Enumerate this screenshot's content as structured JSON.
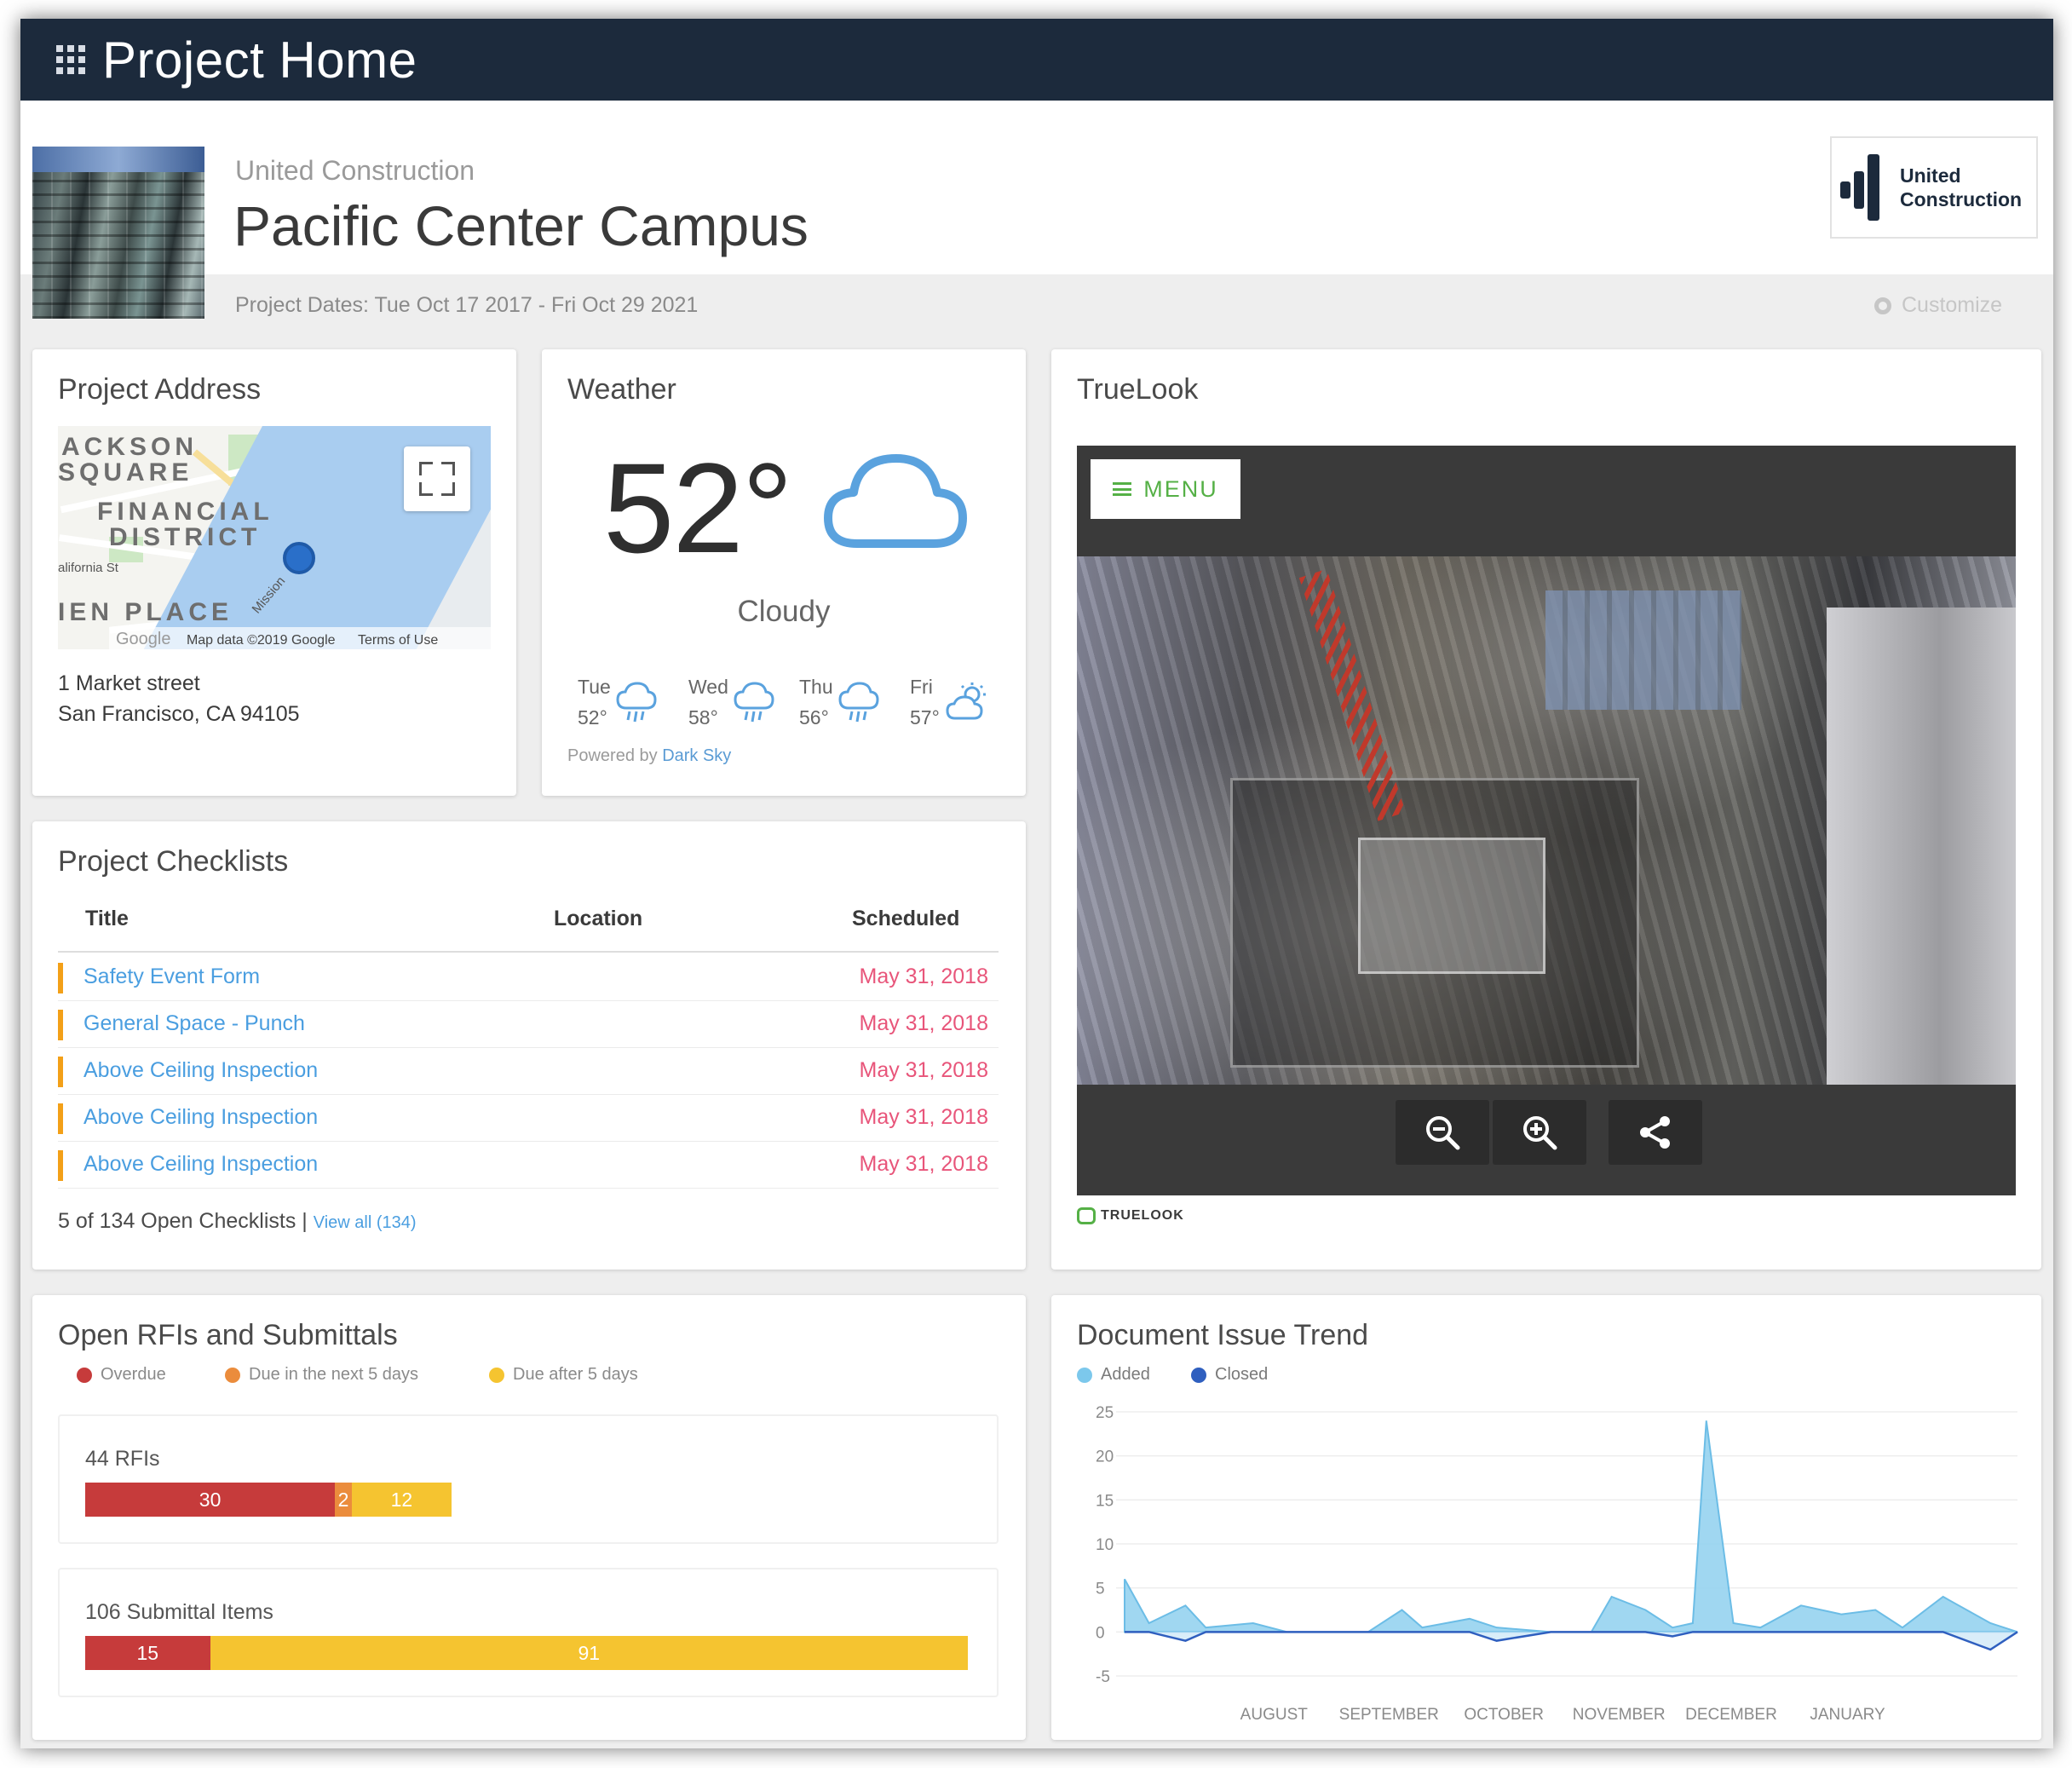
{
  "app": {
    "title": "Project Home",
    "apps_icon": "app-grid-icon"
  },
  "project": {
    "company": "United Construction",
    "name": "Pacific Center Campus",
    "dates": "Project Dates: Tue Oct 17 2017 - Fri Oct 29 2021",
    "customize_label": "Customize",
    "logo_line1": "United",
    "logo_line2": "Construction"
  },
  "address": {
    "title": "Project Address",
    "line1": "1 Market street",
    "line2": "San Francisco, CA 94105",
    "map_labels": [
      "ACKSON",
      "SQUARE",
      "FINANCIAL",
      "DISTRICT",
      "IEN PLACE"
    ],
    "map_small_labels": [
      "alifornia St",
      "Mission"
    ],
    "map_attribution": "Map data ©2019 Google",
    "map_terms": "Terms of Use",
    "map_brand": "Google"
  },
  "weather": {
    "title": "Weather",
    "temperature": "52°",
    "condition": "Cloudy",
    "condition_icon": "cloud-icon",
    "forecast": [
      {
        "day": "Tue",
        "temp": "52°",
        "icon": "rain-cloud-icon"
      },
      {
        "day": "Wed",
        "temp": "58°",
        "icon": "rain-cloud-icon"
      },
      {
        "day": "Thu",
        "temp": "56°",
        "icon": "rain-cloud-icon"
      },
      {
        "day": "Fri",
        "temp": "57°",
        "icon": "partly-cloudy-icon"
      }
    ],
    "powered_prefix": "Powered by",
    "powered_link": "Dark Sky"
  },
  "truelook": {
    "title": "TrueLook",
    "menu_label": "MENU",
    "controls": [
      "zoom-out-icon",
      "zoom-in-icon",
      "share-icon"
    ],
    "brand": "TRUELOOK"
  },
  "checklists": {
    "title": "Project Checklists",
    "columns": [
      "Title",
      "Location",
      "Scheduled"
    ],
    "rows": [
      {
        "title": "Safety Event Form",
        "location": "",
        "scheduled": "May 31, 2018"
      },
      {
        "title": "General Space - Punch",
        "location": "",
        "scheduled": "May 31, 2018"
      },
      {
        "title": "Above Ceiling Inspection",
        "location": "",
        "scheduled": "May 31, 2018"
      },
      {
        "title": "Above Ceiling Inspection",
        "location": "",
        "scheduled": "May 31, 2018"
      },
      {
        "title": "Above Ceiling Inspection",
        "location": "",
        "scheduled": "May 31, 2018"
      }
    ],
    "footer": "5 of 134 Open Checklists |",
    "view_all": "View all (134)",
    "accent": "#f3a018"
  },
  "rfis": {
    "title": "Open RFIs and Submittals",
    "legend": [
      {
        "label": "Overdue",
        "color": "#c63b3b"
      },
      {
        "label": "Due in the next 5 days",
        "color": "#eb8c3c"
      },
      {
        "label": "Due after 5 days",
        "color": "#f5c430"
      }
    ],
    "groups": [
      {
        "label": "44 RFIs",
        "segments": [
          30,
          2,
          12
        ]
      },
      {
        "label": "106 Submittal Items",
        "segments": [
          15,
          91
        ]
      }
    ]
  },
  "trend": {
    "title": "Document Issue Trend",
    "legend": [
      {
        "label": "Added",
        "color": "#7cc8ec"
      },
      {
        "label": "Closed",
        "color": "#2f5fbf"
      }
    ]
  },
  "chart_data": {
    "type": "area",
    "title": "Document Issue Trend",
    "xlabel": "",
    "ylabel": "",
    "ylim": [
      -5,
      25
    ],
    "yticks": [
      25,
      20,
      15,
      10,
      5,
      0,
      -5
    ],
    "categories": [
      "AUGUST",
      "SEPTEMBER",
      "OCTOBER",
      "NOVEMBER",
      "DECEMBER",
      "JANUARY"
    ],
    "x": [
      0,
      0.18,
      0.45,
      0.6,
      0.95,
      1.2,
      1.4,
      1.8,
      2.05,
      2.2,
      2.55,
      2.75,
      3.15,
      3.45,
      3.6,
      3.85,
      4.05,
      4.2,
      4.3,
      4.5,
      4.7,
      5.0,
      5.3,
      5.55,
      5.75,
      6.05,
      6.4,
      6.6
    ],
    "series": [
      {
        "name": "Added",
        "values": [
          6,
          1,
          3,
          0.5,
          1,
          0,
          0,
          0,
          2.5,
          0.5,
          1.5,
          0.5,
          0,
          0,
          4,
          2.5,
          0.5,
          1,
          24,
          1,
          0.5,
          3,
          2,
          2.5,
          0.5,
          4,
          1,
          0
        ]
      },
      {
        "name": "Closed",
        "values": [
          0,
          0,
          -1,
          0,
          0,
          0,
          0,
          0,
          0,
          0,
          0,
          -1,
          0,
          0,
          0,
          0,
          -0.5,
          0,
          0,
          0,
          0,
          0,
          0,
          0,
          0,
          0,
          -2,
          0
        ]
      }
    ],
    "grid": true,
    "legend_position": "top-left"
  }
}
